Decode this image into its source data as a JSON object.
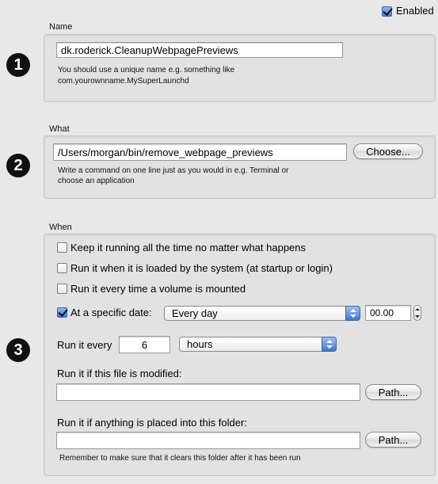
{
  "enabled": {
    "label": "Enabled",
    "checked": true
  },
  "name_section": {
    "label": "Name",
    "badge": "1",
    "value": "dk.roderick.CleanupWebpagePreviews",
    "help_line1": "You should use a unique name e.g. something like",
    "help_line2": "com.yourownname.MySuperLaunchd"
  },
  "what_section": {
    "label": "What",
    "badge": "2",
    "value": "/Users/morgan/bin/remove_webpage_previews",
    "choose_button": "Choose...",
    "help_line1": "Write a command on one line just as you would in e.g. Terminal or",
    "help_line2": "choose an application"
  },
  "when_section": {
    "label": "When",
    "badge": "3",
    "options": [
      {
        "label": "Keep it running all the time no matter what happens",
        "checked": false
      },
      {
        "label": "Run it when it is loaded by the system (at startup or login)",
        "checked": false
      },
      {
        "label": "Run it every time a volume is mounted",
        "checked": false
      }
    ],
    "specific_date": {
      "label": "At a specific date:",
      "checked": true,
      "frequency": "Every day",
      "time": "00.00"
    },
    "run_every": {
      "label": "Run it every",
      "value": "6",
      "unit": "hours"
    },
    "file_modified": {
      "label": "Run it if this file is modified:",
      "value": "",
      "path_button": "Path..."
    },
    "folder": {
      "label": "Run it if anything is placed into this folder:",
      "value": "",
      "path_button": "Path...",
      "note": "Remember to make sure that it clears this folder after it has been run"
    }
  }
}
